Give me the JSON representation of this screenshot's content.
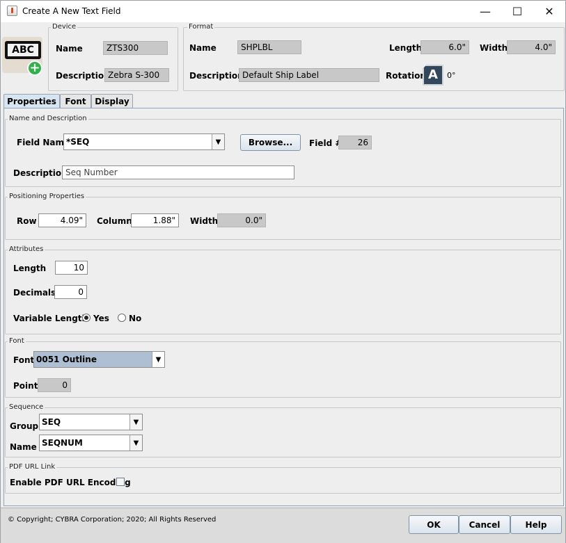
{
  "window": {
    "title": "Create A New Text Field",
    "minimize_glyph": "—",
    "maximize_glyph": "☐",
    "close_glyph": "✕"
  },
  "device_icon": {
    "text": "ABC",
    "icon": "add-text-field-icon"
  },
  "device": {
    "legend": "Device",
    "name_label": "Name",
    "name_value": "ZTS300",
    "description_label": "Description",
    "description_value": "Zebra S-300"
  },
  "format": {
    "legend": "Format",
    "name_label": "Name",
    "name_value": "SHPLBL",
    "length_label": "Length",
    "length_value": "6.0\"",
    "width_label": "Width",
    "width_value": "4.0\"",
    "description_label": "Description",
    "description_value": "Default Ship Label",
    "rotation_label": "Rotation",
    "rotation_icon_letter": "A",
    "rotation_value": "0°"
  },
  "tabs": [
    {
      "label": "Properties",
      "active": true
    },
    {
      "label": "Font",
      "active": false
    },
    {
      "label": "Display",
      "active": false
    }
  ],
  "name_desc": {
    "legend": "Name and Description",
    "field_name_label": "Field Name",
    "field_name_value": "*SEQ",
    "browse_label": "Browse...",
    "field_num_label": "Field #",
    "field_num_value": "26",
    "description_label": "Description",
    "description_value": "Seq Number"
  },
  "positioning": {
    "legend": "Positioning Properties",
    "row_label": "Row",
    "row_value": "4.09\"",
    "column_label": "Column",
    "column_value": "1.88\"",
    "width_label": "Width",
    "width_value": "0.0\""
  },
  "attributes": {
    "legend": "Attributes",
    "length_label": "Length",
    "length_value": "10",
    "decimals_label": "Decimals",
    "decimals_value": "0",
    "variable_length_label": "Variable Length",
    "yes_label": "Yes",
    "no_label": "No",
    "variable_length_selected": "Yes"
  },
  "font": {
    "legend": "Font",
    "font_label": "Font",
    "font_value": "0051 Outline",
    "point_label": "Point",
    "point_value": "0"
  },
  "sequence": {
    "legend": "Sequence",
    "group_label": "Group",
    "group_value": "SEQ",
    "name_label": "Name",
    "name_value": "SEQNUM"
  },
  "pdf": {
    "legend": "PDF URL Link",
    "enable_label": "Enable PDF URL Encoding",
    "enabled": false
  },
  "footer": {
    "copyright": "© Copyright; CYBRA Corporation; 2020; All Rights Reserved",
    "ok_label": "OK",
    "cancel_label": "Cancel",
    "help_label": "Help"
  },
  "colors": {
    "readonly_field": "#c8c8c8",
    "selected_combo": "#aebfd4",
    "active_tab": "#d7e4f1",
    "add_badge": "#2fb24a"
  }
}
